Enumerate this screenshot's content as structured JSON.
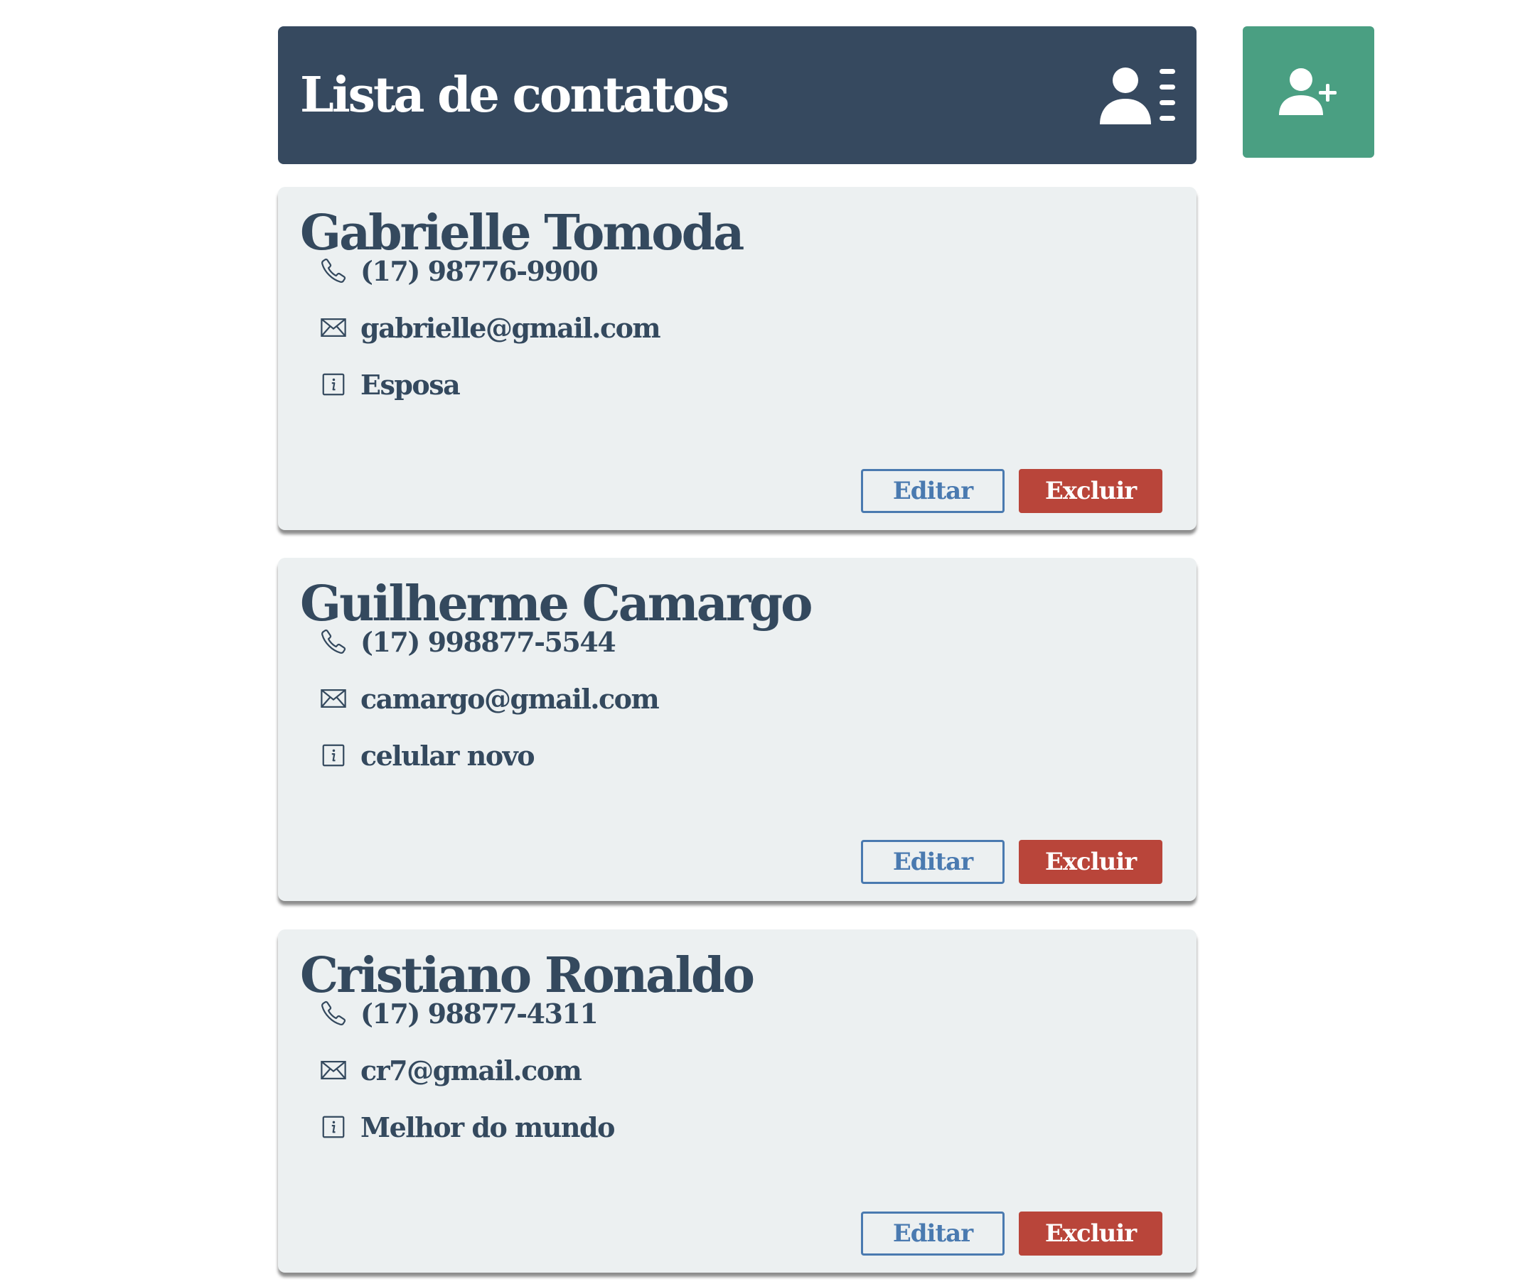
{
  "header": {
    "title": "Lista de contatos",
    "icon": "address-book-icon",
    "background_color": "#36495f"
  },
  "add_contact_button": {
    "icon": "user-plus-icon",
    "color": "#4a9f82"
  },
  "contacts": [
    {
      "name": "Gabrielle Tomoda",
      "phone": "(17) 98776-9900",
      "email": "gabrielle@gmail.com",
      "description": "Esposa",
      "edit_label": "Editar",
      "delete_label": "Excluir"
    },
    {
      "name": "Guilherme Camargo",
      "phone": "(17) 998877-5544",
      "email": "camargo@gmail.com",
      "description": "celular novo",
      "edit_label": "Editar",
      "delete_label": "Excluir"
    },
    {
      "name": "Cristiano Ronaldo",
      "phone": "(17) 98877-4311",
      "email": "cr7@gmail.com",
      "description": "Melhor do mundo",
      "edit_label": "Editar",
      "delete_label": "Excluir"
    }
  ],
  "colors": {
    "card_background": "#ecf0f1",
    "text": "#34495e",
    "edit_accent": "#4a7ab0",
    "delete_accent": "#b9453a"
  }
}
